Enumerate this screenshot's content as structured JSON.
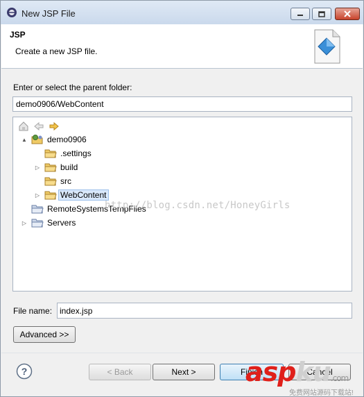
{
  "window": {
    "title": "New JSP File",
    "controls": {
      "minimize": "minimize",
      "maximize": "maximize",
      "close": "close"
    }
  },
  "banner": {
    "title": "JSP",
    "description": "Create a new JSP file."
  },
  "parent_folder": {
    "label": "Enter or select the parent folder:",
    "value": "demo0906/WebContent"
  },
  "tree": {
    "items": [
      {
        "label": "demo0906",
        "icon": "project-icon",
        "expanded": true
      },
      {
        "label": ".settings",
        "icon": "folder-icon",
        "expanded": false
      },
      {
        "label": "build",
        "icon": "folder-icon",
        "expanded": false
      },
      {
        "label": "src",
        "icon": "folder-icon",
        "expanded": false
      },
      {
        "label": "WebContent",
        "icon": "folder-icon",
        "expanded": false,
        "selected": true
      },
      {
        "label": "RemoteSystemsTempFiles",
        "icon": "project-folder-icon",
        "expanded": false
      },
      {
        "label": "Servers",
        "icon": "project-folder-icon",
        "expanded": false
      }
    ]
  },
  "watermark": "http://blog.csdn.net/HoneyGirls",
  "file_name": {
    "label": "File name:",
    "value": "index.jsp"
  },
  "buttons": {
    "advanced": "Advanced >>",
    "back": "< Back",
    "next": "Next >",
    "finish": "Finish",
    "cancel": "Cancel"
  },
  "logo": {
    "text_main": "asp",
    "text_tail": "ku",
    "domain": ".com",
    "subtitle": "免费网站源码下载站!"
  },
  "colors": {
    "accent": "#3c7fb1",
    "folder": "#e9b646",
    "selection": "#d9e8fb",
    "logo_red": "#e0201a"
  }
}
